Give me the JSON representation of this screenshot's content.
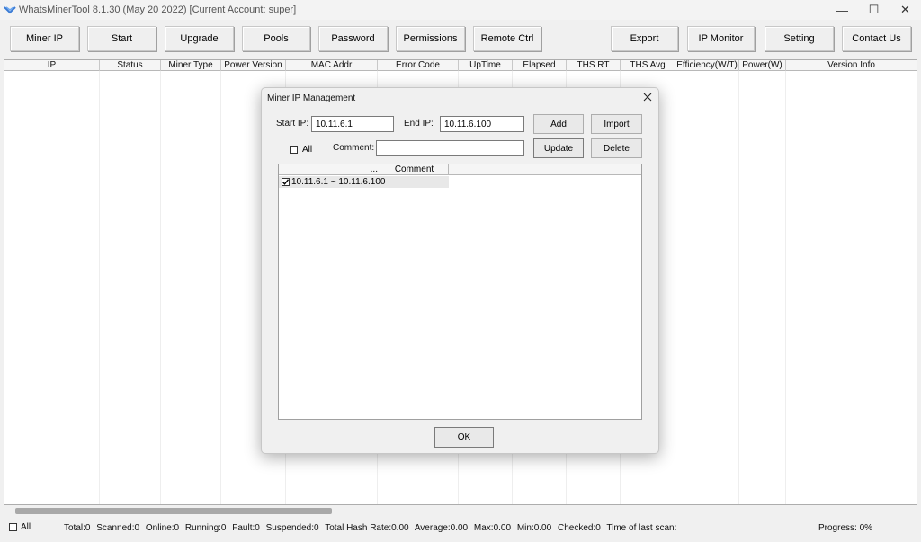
{
  "window": {
    "title": "WhatsMinerTool 8.1.30 (May 20 2022) [Current Account: super]",
    "controls": {
      "minimize": "—",
      "maximize": "☐",
      "close": "✕"
    }
  },
  "toolbar": {
    "buttons": [
      "Miner IP",
      "Start",
      "Upgrade",
      "Pools",
      "Password",
      "Permissions",
      "Remote Ctrl",
      "Export",
      "IP Monitor",
      "Setting",
      "Contact Us"
    ]
  },
  "grid": {
    "columns": [
      "IP",
      "Status",
      "Miner Type",
      "Power Version",
      "MAC Addr",
      "Error Code",
      "UpTime",
      "Elapsed",
      "THS RT",
      "THS Avg",
      "Efficiency(W/T)",
      "Power(W)",
      "Version Info"
    ]
  },
  "statusbar": {
    "all_label": "All",
    "stats": [
      "Total:0",
      "Scanned:0",
      "Online:0",
      "Running:0",
      "Fault:0",
      "Suspended:0",
      "Total Hash Rate:0.00",
      "Average:0.00",
      "Max:0.00",
      "Min:0.00",
      "Checked:0",
      "Time of last scan:"
    ],
    "progress": "Progress: 0%"
  },
  "dialog": {
    "title": "Miner IP Management",
    "start_ip_label": "Start IP:",
    "start_ip_value": "10.11.6.1",
    "end_ip_label": "End IP:",
    "end_ip_value": "10.11.6.100",
    "all_label": "All",
    "comment_label": "Comment:",
    "comment_value": "",
    "buttons": {
      "add": "Add",
      "import": "Import",
      "update": "Update",
      "delete": "Delete",
      "ok": "OK"
    },
    "list": {
      "columns": [
        "...",
        "Comment"
      ],
      "rows": [
        {
          "checked": true,
          "range": "10.11.6.1 ~ 10.11.6.100",
          "comment": ""
        }
      ]
    }
  }
}
